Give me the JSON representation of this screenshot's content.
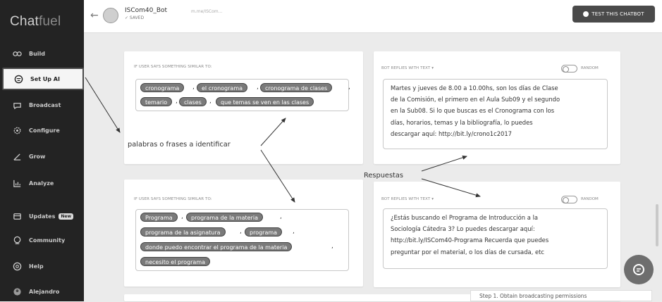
{
  "app": {
    "logo_main": "Chat",
    "logo_accent": "fuel"
  },
  "sidebar": {
    "items": [
      {
        "label": "Build",
        "icon": "build-icon"
      },
      {
        "label": "Set Up AI",
        "icon": "ai-icon",
        "active": true
      },
      {
        "label": "Broadcast",
        "icon": "broadcast-icon"
      },
      {
        "label": "Configure",
        "icon": "gear-icon"
      },
      {
        "label": "Grow",
        "icon": "grow-icon"
      },
      {
        "label": "Analyze",
        "icon": "chart-icon"
      },
      {
        "label": "Updates",
        "icon": "bell-icon",
        "badge": "New"
      },
      {
        "label": "Community",
        "icon": "community-icon"
      },
      {
        "label": "Help",
        "icon": "help-icon"
      },
      {
        "label": "Alejandro",
        "icon": "user-avatar"
      }
    ]
  },
  "topbar": {
    "back": "←",
    "bot_name": "ISCom40_Bot",
    "bot_status": "✓ SAVED",
    "bot_url": "m.me/ISCom…",
    "test_button": "TEST THIS CHATBOT"
  },
  "rules": [
    {
      "user_says_label": "IF USER SAYS SOMETHING SIMILAR TO:",
      "bot_replies_label": "BOT REPLIES WITH TEXT ▾",
      "random_label": "RANDOM",
      "keywords": [
        "cronograma",
        "el cronograma",
        "cronograma de clases",
        "temario",
        "clases",
        "que temas se ven en las clases"
      ],
      "reply_lines": [
        "Martes y jueves de 8.00 a 10.00hs, son los días de Clase",
        "de la Comisión, el primero en el Aula Sub09 y el segundo",
        "en la Sub08. Si lo que buscas es el Cronograma con los",
        "días, horarios, temas y la bibliografía, lo puedes",
        "descargar aquí: http://bit.ly/crono1c2017"
      ]
    },
    {
      "user_says_label": "IF USER SAYS SOMETHING SIMILAR TO:",
      "bot_replies_label": "BOT REPLIES WITH TEXT ▾",
      "random_label": "RANDOM",
      "keywords": [
        "Programa",
        "programa de la materia",
        "programa de la asignatura",
        "programa",
        "donde puedo encontrar el programa de la materia",
        "necesito el programa"
      ],
      "reply_lines": [
        "¿Estás buscando el Programa de Introducción a la",
        "Sociología Cátedra 3? Lo puedes descargar aquí:",
        "http://bit.ly/ISCom40-Programa Recuerda que puedes",
        "preguntar por el material, o los días de cursada, etc"
      ]
    }
  ],
  "annotations": {
    "keywords_note": "palabras o frases a identificar",
    "replies_note": "Respuestas"
  },
  "footer": {
    "step_text": "Step 1. Obtain broadcasting permissions"
  },
  "colors": {
    "sidebar_bg": "#232323",
    "chip_bg": "#7a7a7a",
    "page_bg": "#ebebeb"
  }
}
